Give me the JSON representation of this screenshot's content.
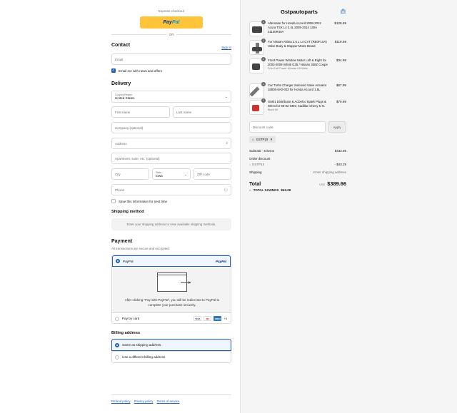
{
  "express": {
    "label": "Express checkout",
    "paypal_a": "Pay",
    "paypal_b": "Pal",
    "or": "OR"
  },
  "contact": {
    "title": "Contact",
    "signin": "Sign in",
    "email_placeholder": "Email",
    "news_label": "Email me with news and offers"
  },
  "delivery": {
    "title": "Delivery",
    "country_label": "Country/Region",
    "country_value": "United States",
    "first_name": "First name",
    "last_name": "Last name",
    "company": "Company (optional)",
    "address": "Address",
    "apartment": "Apartment, suite, etc. (optional)",
    "city": "City",
    "state_label": "State",
    "state_value": "Iowa",
    "zip": "ZIP code",
    "phone": "Phone",
    "save_label": "Save this information for next time"
  },
  "shipping": {
    "title": "Shipping method",
    "info": "Enter your shipping address to view available shipping methods."
  },
  "payment": {
    "title": "Payment",
    "note": "All transactions are secure and encrypted.",
    "paypal_label": "PayPal",
    "paypal_brand": "PayPal",
    "redirect_msg": "After clicking “Pay with PayPal”, you will be redirected to PayPal to complete your purchase securely.",
    "card_label": "Pay by card",
    "card_icons": [
      "VISA",
      "MC",
      "AMEX"
    ],
    "more_cards": "+5"
  },
  "billing": {
    "title": "Billing address",
    "same": "Same as shipping address",
    "different": "Use a different billing address"
  },
  "footer": {
    "refund": "Refund policy",
    "privacy": "Privacy policy",
    "terms": "Terms of service"
  },
  "summary": {
    "store": "Gstpautoparts",
    "items": [
      {
        "qty": "1",
        "name": "Alternator for Honda Accord 2008-2012 Acura TSX L4 2.4L 2009-2014 130A 31100R40A",
        "variant": "",
        "price": "$129.99"
      },
      {
        "qty": "1",
        "name": "For Nissan Altima 2.5 L L4 CVT (RE0F10A) Valve Body & Stepper Motor Brand",
        "variant": "",
        "price": "$119.99"
      },
      {
        "qty": "1",
        "name": "Front Power Window Motor Left & Right for 2003-2009 Infiniti G35 / Nissan 350Z Coupe",
        "variant": "Front Left Power Window Lift Motor",
        "price": "$34.99"
      },
      {
        "qty": "1",
        "name": "Car Turbo Charger Solenoid Valve Actuator 18805-6A0-003 for Honda Accord 1.5L",
        "variant": "",
        "price": "$67.99"
      },
      {
        "qty": "1",
        "name": "GM01 Distributor & AcDelco Spark Plugs & Wires for 96-02 GMC Cadillac Chevy 5.7L",
        "variant": "Black Kit",
        "price": "$79.99"
      }
    ],
    "discount_placeholder": "Discount code",
    "apply": "Apply",
    "code": "GSTP10",
    "subtotal_label": "Subtotal · 5 items",
    "subtotal": "$432.95",
    "order_discount": "Order discount",
    "discount_code": "GSTP10",
    "discount_amount": "- $43.29",
    "shipping_label": "Shipping",
    "shipping_value": "Enter shipping address",
    "total_label": "Total",
    "currency": "USD",
    "total": "$389.66",
    "savings_label": "TOTAL SAVINGS",
    "savings": "$43.29"
  }
}
